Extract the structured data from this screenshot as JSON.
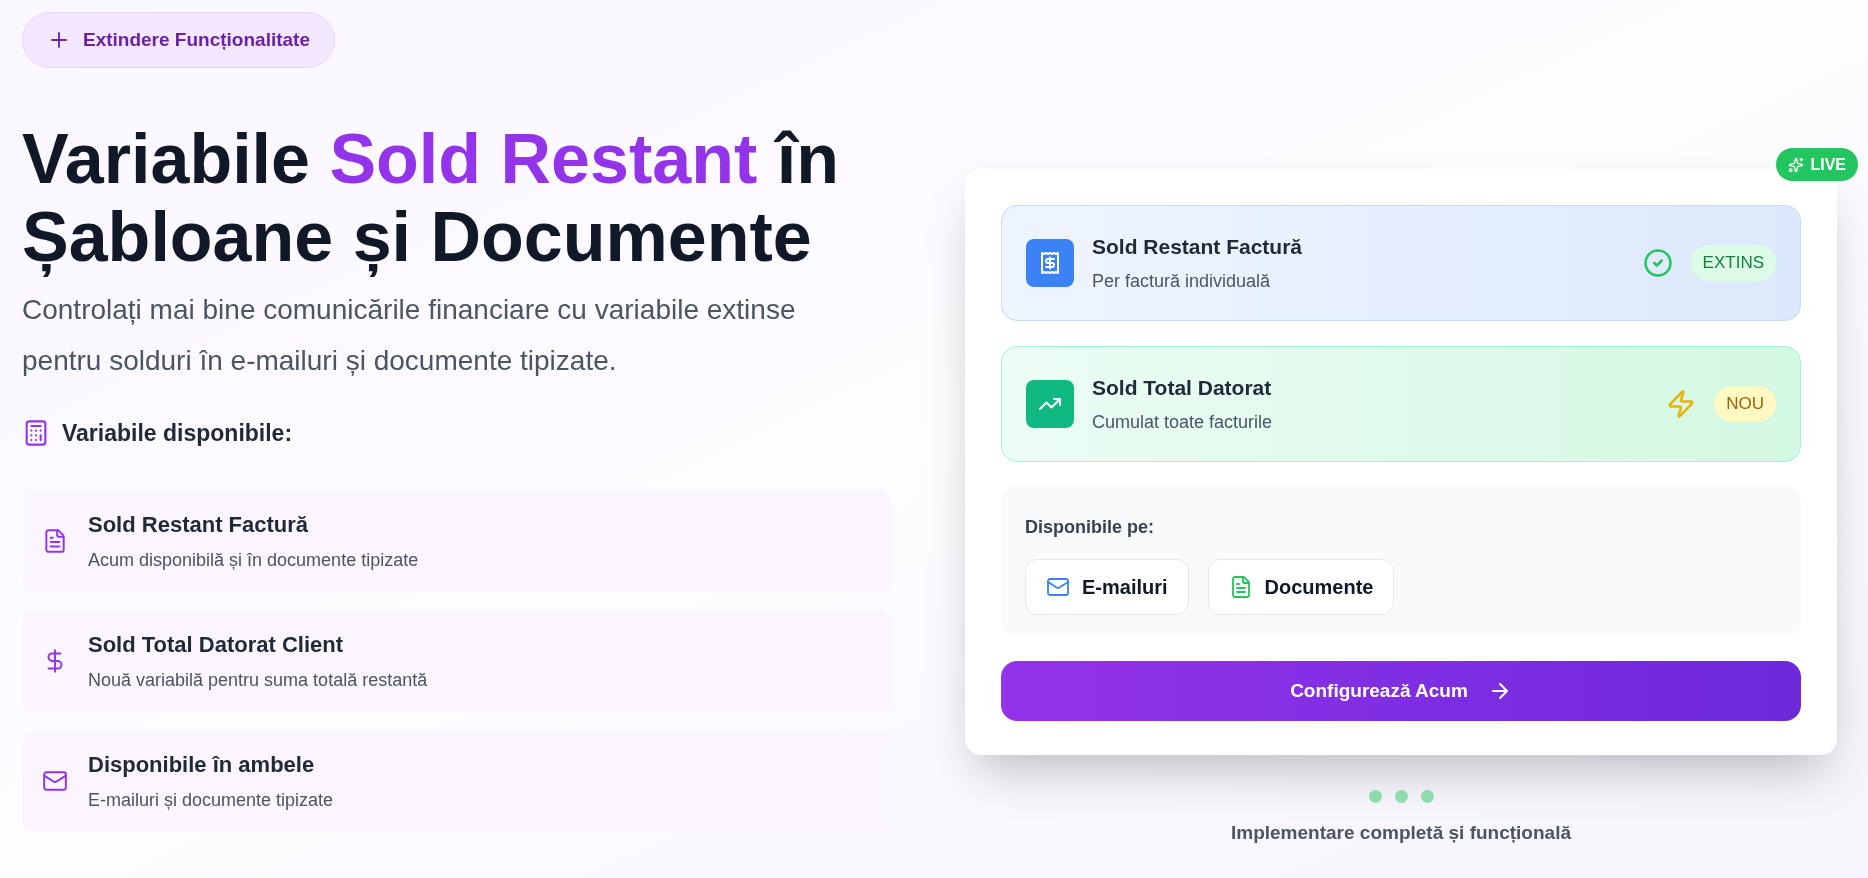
{
  "badge": {
    "label": "Extindere Funcționalitate"
  },
  "title": [
    {
      "text": "Variabile ",
      "highlight": false
    },
    {
      "text": "Sold Restant",
      "highlight": true
    },
    {
      "text": " în Șabloane și Documente",
      "highlight": false
    }
  ],
  "subtitle": "Controlați mai bine comunicările financiare cu variabile extinse pentru solduri în e-mailuri și documente tipizate.",
  "variables_heading": "Variabile disponibile:",
  "variables": [
    {
      "kind": "document",
      "title": "Sold Restant Factură",
      "description": "Acum disponibilă și în documente tipizate"
    },
    {
      "kind": "dollar",
      "title": "Sold Total Datorat Client",
      "description": "Nouă variabilă pentru suma totală restantă"
    },
    {
      "kind": "mail",
      "title": "Disponibile în ambele",
      "description": "E-mailuri și documente tipizate"
    }
  ],
  "live_badge": "LIVE",
  "features": [
    {
      "kind": "invoice",
      "title": "Sold Restant Factură",
      "subtitle": "Per factură individuală",
      "tag": "EXTINS"
    },
    {
      "kind": "total",
      "title": "Sold Total Datorat",
      "subtitle": "Cumulat toate facturile",
      "tag": "NOU"
    }
  ],
  "available": {
    "label": "Disponibile pe:",
    "platforms": [
      {
        "kind": "email",
        "label": "E-mailuri"
      },
      {
        "kind": "document",
        "label": "Documente"
      }
    ]
  },
  "cta": "Configurează Acum",
  "footer": "Implementare completă și funcțională"
}
